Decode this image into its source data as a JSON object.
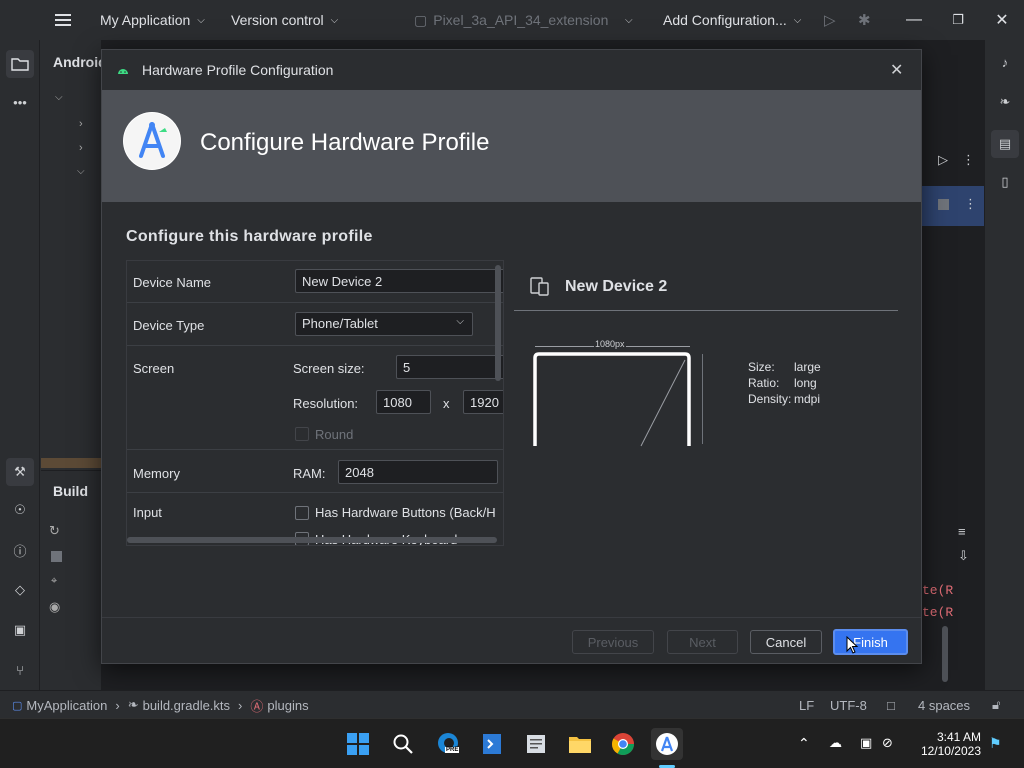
{
  "titlebar": {
    "project": "My Application",
    "vcs": "Version control",
    "device": "Pixel_3a_API_34_extension",
    "config": "Add Configuration..."
  },
  "sidebar": {
    "panel_title": "Android",
    "build_title": "Build"
  },
  "editor": {
    "code_line1": "te(R",
    "code_line2": "te(R"
  },
  "dialog": {
    "title": "Hardware Profile Configuration",
    "header": "Configure Hardware Profile",
    "subtitle": "Configure this hardware profile",
    "form": {
      "device_name_label": "Device Name",
      "device_name_value": "New Device 2",
      "device_type_label": "Device Type",
      "device_type_value": "Phone/Tablet",
      "screen_label": "Screen",
      "screen_size_label": "Screen size:",
      "screen_size_value": "5",
      "resolution_label": "Resolution:",
      "resolution_w": "1080",
      "resolution_x": "x",
      "resolution_h": "1920",
      "round_label": "Round",
      "memory_label": "Memory",
      "ram_label": "RAM:",
      "ram_value": "2048",
      "input_label": "Input",
      "hw_buttons_label": "Has Hardware Buttons (Back/H",
      "hw_keyboard_label": "Has Hardware Keyboard"
    },
    "preview": {
      "device_name": "New Device 2",
      "width_px": "1080px",
      "size_label": "Size:",
      "size_value": "large",
      "ratio_label": "Ratio:",
      "ratio_value": "long",
      "density_label": "Density:",
      "density_value": "mdpi"
    },
    "buttons": {
      "previous": "Previous",
      "next": "Next",
      "cancel": "Cancel",
      "finish": "Finish"
    }
  },
  "statusbar": {
    "project": "MyApplication",
    "file": "build.gradle.kts",
    "symbol": "plugins",
    "line_sep": "LF",
    "encoding": "UTF-8",
    "indent": "4 spaces"
  },
  "taskbar": {
    "time": "3:41 AM",
    "date": "12/10/2023",
    "edge_badge": "PRE"
  },
  "colors": {
    "accent": "#3574f0",
    "android_green": "#3ddc84",
    "dialog_banner": "#4e5157"
  }
}
